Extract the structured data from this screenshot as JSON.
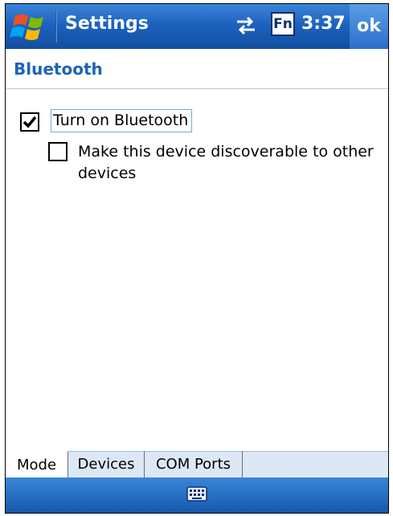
{
  "titlebar": {
    "start_icon": "windows-flag-icon",
    "title": "Settings",
    "connectivity_icon": "connectivity-arrows-icon",
    "fn_label": "Fn",
    "time": "3:37",
    "ok_label": "ok"
  },
  "page": {
    "heading": "Bluetooth"
  },
  "options": [
    {
      "label": "Turn on Bluetooth",
      "checked": true
    },
    {
      "label": "Make this device discoverable to other devices",
      "checked": false
    }
  ],
  "tabs": [
    {
      "label": "Mode",
      "active": true
    },
    {
      "label": "Devices",
      "active": false
    },
    {
      "label": "COM Ports",
      "active": false
    }
  ],
  "menubar": {
    "sip_icon": "keyboard-icon"
  },
  "colors": {
    "titlebar": "#1d62bf",
    "heading": "#1a64b8",
    "tabstrip": "#dce8f6"
  }
}
